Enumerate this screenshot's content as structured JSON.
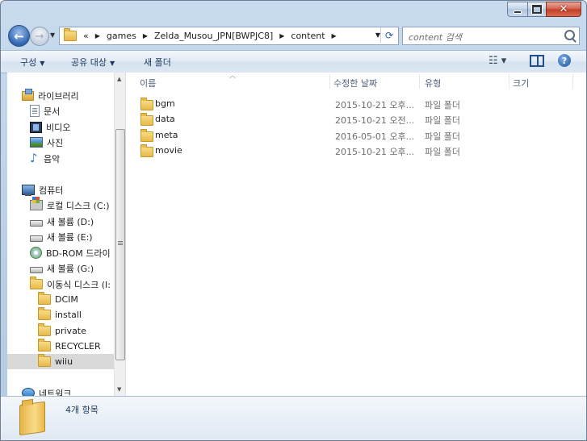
{
  "nav": {
    "breadcrumb_overflow": "«",
    "breadcrumbs": [
      "games",
      "Zelda_Musou_JPN[BWPJC8]",
      "content"
    ],
    "search_placeholder": "content 검색"
  },
  "toolbar": {
    "organize": "구성",
    "share": "공유 대상",
    "new_folder": "새 폴더"
  },
  "sidebar": {
    "items": [
      {
        "label": "라이브러리",
        "icon": "library-icon"
      },
      {
        "label": "문서",
        "icon": "document-icon"
      },
      {
        "label": "비디오",
        "icon": "video-icon"
      },
      {
        "label": "사진",
        "icon": "picture-icon"
      },
      {
        "label": "음악",
        "icon": "music-icon"
      },
      {
        "label": "컴퓨터",
        "icon": "computer-icon"
      },
      {
        "label": "로컬 디스크 (C:)",
        "icon": "windows-drive-icon"
      },
      {
        "label": "새 볼륨 (D:)",
        "icon": "drive-icon"
      },
      {
        "label": "새 볼륨 (E:)",
        "icon": "drive-icon"
      },
      {
        "label": "BD-ROM 드라이",
        "icon": "bd-rom-icon"
      },
      {
        "label": "새 볼륨 (G:)",
        "icon": "drive-icon"
      },
      {
        "label": "이동식 디스크 (I:",
        "icon": "folder-icon"
      },
      {
        "label": "DCIM",
        "icon": "folder-icon"
      },
      {
        "label": "install",
        "icon": "folder-icon"
      },
      {
        "label": "private",
        "icon": "folder-icon"
      },
      {
        "label": "RECYCLER",
        "icon": "folder-icon"
      },
      {
        "label": "wiiu",
        "icon": "folder-icon"
      },
      {
        "label": "네트워크",
        "icon": "network-icon"
      }
    ]
  },
  "columns": [
    "이름",
    "수정한 날짜",
    "유형",
    "크기"
  ],
  "files": [
    {
      "name": "bgm",
      "modified": "2015-10-21 오후...",
      "type": "파일 폴더",
      "size": ""
    },
    {
      "name": "data",
      "modified": "2015-10-21 오전...",
      "type": "파일 폴더",
      "size": ""
    },
    {
      "name": "meta",
      "modified": "2016-05-01 오후...",
      "type": "파일 폴더",
      "size": ""
    },
    {
      "name": "movie",
      "modified": "2015-10-21 오후...",
      "type": "파일 폴더",
      "size": ""
    }
  ],
  "details": {
    "item_count": "4개 항목"
  }
}
